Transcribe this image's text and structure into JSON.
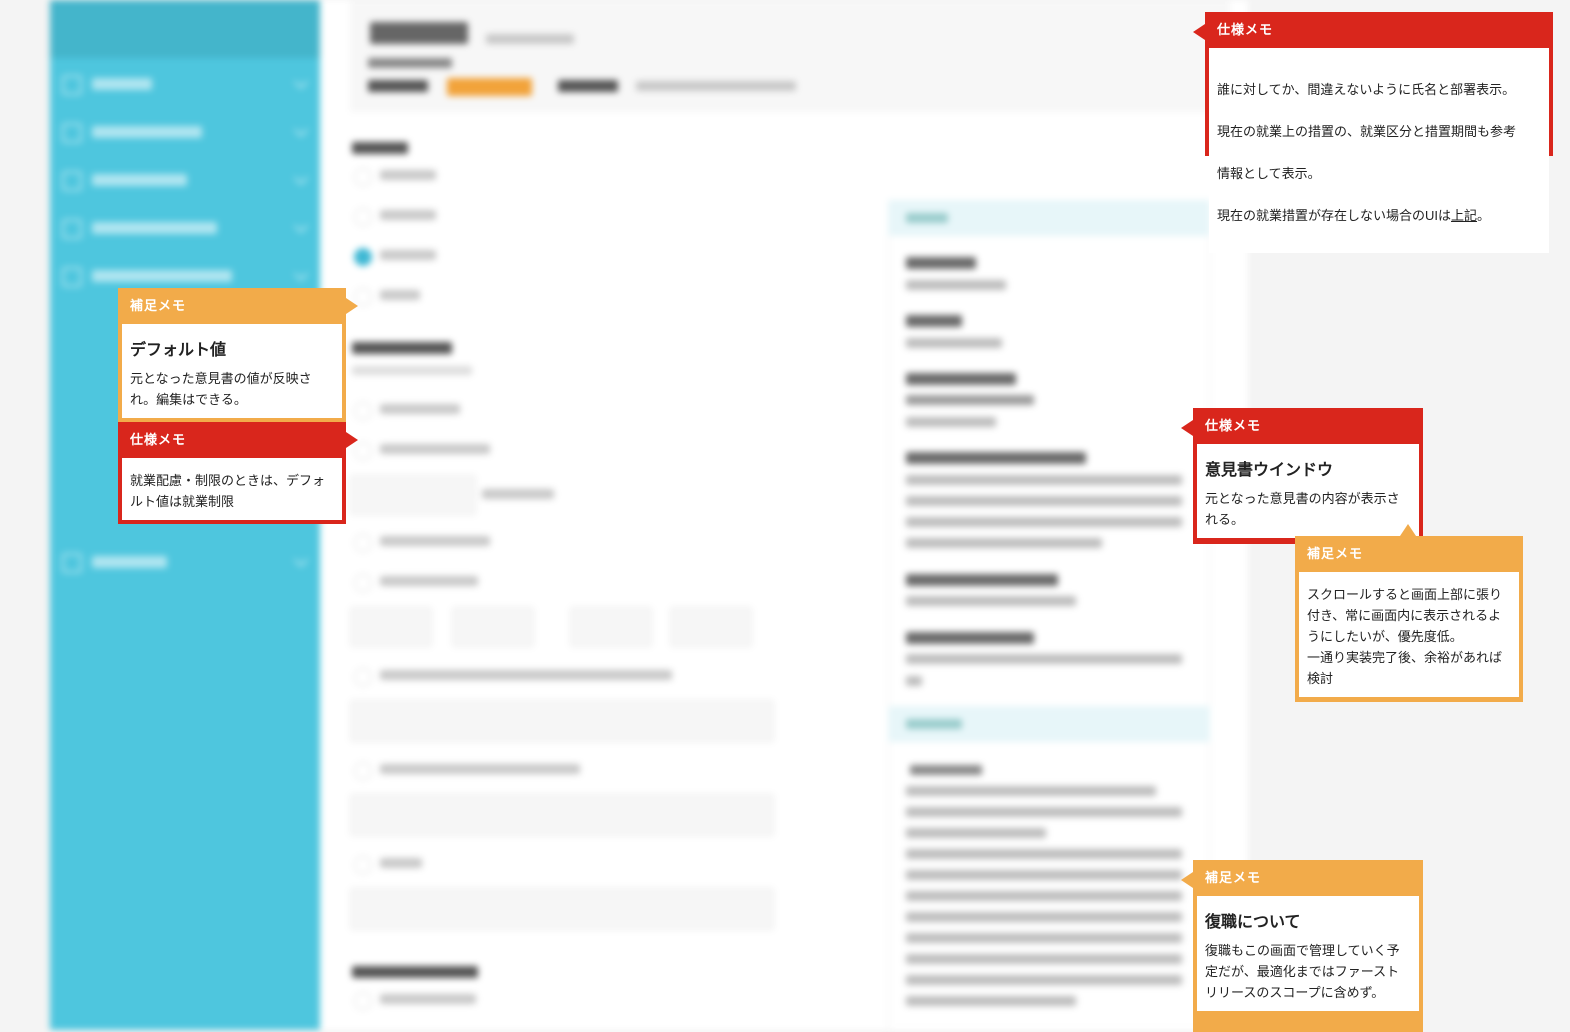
{
  "memos": {
    "spec_top": {
      "header": "仕様メモ",
      "line1": "誰に対してか、間違えないように氏名と部署表示。",
      "line2": "現在の就業上の措置の、就業区分と措置期間も参考",
      "line3": "情報として表示。",
      "line4_pre": "現在の就業措置が存在しない場合のUIは",
      "line4_link": "上記",
      "line4_post": "。"
    },
    "supp_default": {
      "header": "補足メモ",
      "title": "デフォルト値",
      "body": "元となった意見書の値が反映され。編集はできる。"
    },
    "spec_default": {
      "header": "仕様メモ",
      "body": "就業配慮・制限のときは、デフォルト値は就業制限"
    },
    "spec_window": {
      "header": "仕様メモ",
      "title": "意見書ウインドウ",
      "body": "元となった意見書の内容が表示される。"
    },
    "supp_scroll": {
      "header": "補足メモ",
      "body": "スクロールすると画面上部に張り付き、常に画面内に表示されるようにしたいが、優先度低。\n一通り実装完了後、余裕があれば検討"
    },
    "supp_return": {
      "header": "補足メモ",
      "title": "復職について",
      "body": "復職もこの画面で管理していく予定だが、最適化まではファーストリリースのスコープに含めず。"
    }
  },
  "colors": {
    "spec_red": "#d9261c",
    "supp_orange": "#f2ab4a",
    "sidebar": "#4ec6de"
  }
}
